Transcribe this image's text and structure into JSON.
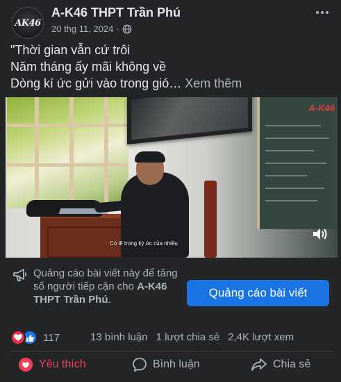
{
  "header": {
    "page_name": "A-K46 THPT Trần Phú",
    "avatar_text": "AK46",
    "date": "20 thg 11, 2024",
    "separator": "·",
    "privacy_icon": "globe-icon",
    "more_icon": "more-horizontal-icon"
  },
  "caption": {
    "lines": [
      "\"Thời gian vẫn cứ trôi",
      "Năm tháng ấy mãi không về",
      "Dòng kí ức gửi vào trong gió…"
    ],
    "see_more": "Xem thêm"
  },
  "video": {
    "board_watermark": "A-K46",
    "subtitle": "Có lẽ trong ký ức của nhiều",
    "volume_icon": "volume-icon"
  },
  "promo": {
    "icon": "megaphone-icon",
    "text_before": "Quảng cáo bài viết này để tăng số người tiếp cận cho",
    "page_name": "A-K46 THPT Trần Phú",
    "text_after": ".",
    "button_label": "Quảng cáo bài viết"
  },
  "stats": {
    "reaction_icons": [
      "heart-icon",
      "like-icon"
    ],
    "reaction_count": "117",
    "comments": "13 bình luận",
    "shares": "1 lượt chia sẻ",
    "views": "2,4K lượt xem"
  },
  "actions": {
    "like": "Yêu thích",
    "comment": "Bình luận",
    "share": "Chia sẻ"
  },
  "colors": {
    "background": "#242526",
    "accent_blue": "#1b74e4",
    "love_red": "#f33e58",
    "secondary_text": "#b0b3b8"
  }
}
